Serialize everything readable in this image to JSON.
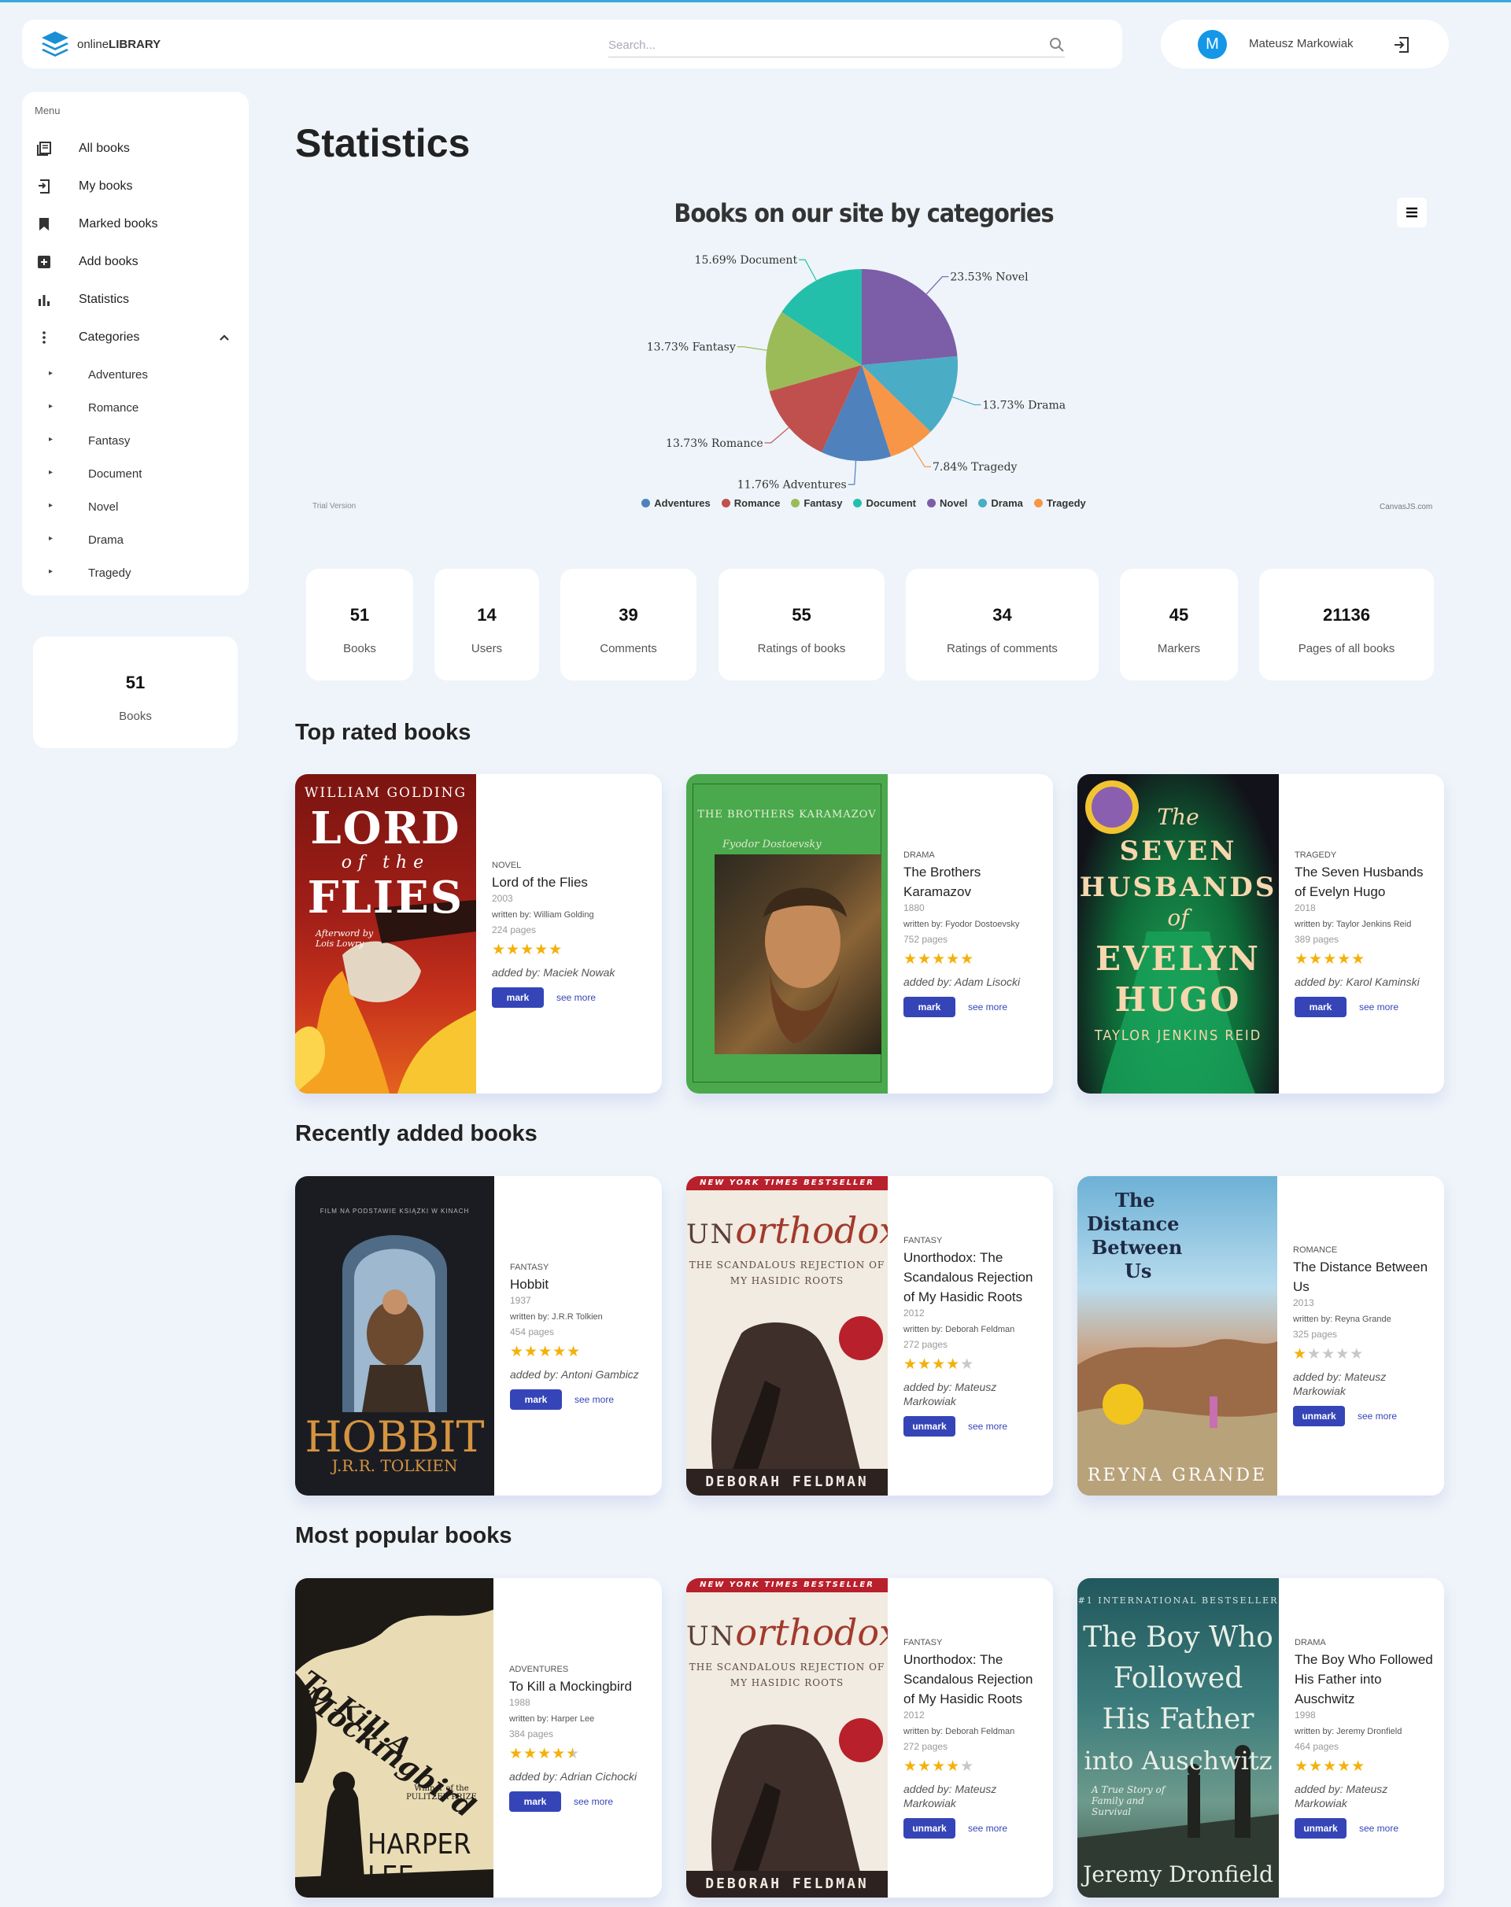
{
  "app": {
    "logo_online": "online",
    "logo_library": "LIBRARY"
  },
  "search": {
    "placeholder": "Search..."
  },
  "user": {
    "initial": "M",
    "name": "Mateusz Markowiak"
  },
  "sidebar": {
    "menu_label": "Menu",
    "items": [
      {
        "label": "All books",
        "icon": "books-icon"
      },
      {
        "label": "My books",
        "icon": "my-books-icon"
      },
      {
        "label": "Marked books",
        "icon": "bookmark-icon"
      },
      {
        "label": "Add books",
        "icon": "plus-box-icon"
      },
      {
        "label": "Statistics",
        "icon": "bar-chart-icon"
      },
      {
        "label": "Categories",
        "icon": "kebab-icon"
      }
    ],
    "categories": [
      "Adventures",
      "Romance",
      "Fantasy",
      "Document",
      "Novel",
      "Drama",
      "Tragedy"
    ],
    "stat": {
      "value": "51",
      "label": "Books"
    }
  },
  "page": {
    "title": "Statistics"
  },
  "chart_data": {
    "type": "pie",
    "title": "Books on our site by categories",
    "slices": [
      {
        "label": "Novel",
        "value": 23.53,
        "color": "#7b5ea7",
        "text": "23.53% Novel"
      },
      {
        "label": "Drama",
        "value": 13.73,
        "color": "#4aacc5",
        "text": "13.73% Drama"
      },
      {
        "label": "Tragedy",
        "value": 7.84,
        "color": "#f79646",
        "text": "7.84% Tragedy"
      },
      {
        "label": "Adventures",
        "value": 11.76,
        "color": "#4f81bd",
        "text": "11.76% Adventures"
      },
      {
        "label": "Romance",
        "value": 13.73,
        "color": "#c0504d",
        "text": "13.73% Romance"
      },
      {
        "label": "Fantasy",
        "value": 13.73,
        "color": "#9bbb59",
        "text": "13.73% Fantasy"
      },
      {
        "label": "Document",
        "value": 15.69,
        "color": "#23bfaa",
        "text": "15.69% Document"
      }
    ],
    "legend": [
      "Adventures",
      "Romance",
      "Fantasy",
      "Document",
      "Novel",
      "Drama",
      "Tragedy"
    ],
    "legend_position": "bottom",
    "trial": "Trial Version",
    "credit": "CanvasJS.com"
  },
  "stats": [
    {
      "value": "51",
      "label": "Books"
    },
    {
      "value": "14",
      "label": "Users"
    },
    {
      "value": "39",
      "label": "Comments"
    },
    {
      "value": "55",
      "label": "Ratings of books"
    },
    {
      "value": "34",
      "label": "Ratings of comments"
    },
    {
      "value": "45",
      "label": "Markers"
    },
    {
      "value": "21136",
      "label": "Pages of all books"
    }
  ],
  "sections": {
    "top_rated": "Top rated books",
    "recent": "Recently added books",
    "popular": "Most popular books"
  },
  "buttons": {
    "mark": "mark",
    "unmark": "unmark",
    "see_more": "see more"
  },
  "top_rated": [
    {
      "category": "NOVEL",
      "title": "Lord of the Flies",
      "year": "2003",
      "author": "written by: William Golding",
      "pages": "224 pages",
      "rating": 5,
      "added": "added by: Maciek Nowak",
      "action": "mark",
      "cover": {
        "author": "WILLIAM GOLDING",
        "l1": "LORD",
        "l2": "of the",
        "l3": "FLIES",
        "note": "Afterword by Lois Lowry"
      }
    },
    {
      "category": "DRAMA",
      "title": "The Brothers Karamazov",
      "year": "1880",
      "author": "written by: Fyodor Dostoevsky",
      "pages": "752 pages",
      "rating": 5,
      "added": "added by: Adam Lisocki",
      "action": "mark",
      "cover": {
        "title": "THE BROTHERS KARAMAZOV",
        "author": "Fyodor Dostoevsky"
      }
    },
    {
      "category": "TRAGEDY",
      "title": "The Seven Husbands of Evelyn Hugo",
      "year": "2018",
      "author": "written by: Taylor Jenkins Reid",
      "pages": "389 pages",
      "rating": 5,
      "added": "added by: Karol Kaminski",
      "action": "mark",
      "cover": {
        "l1": "The",
        "l2": "SEVEN",
        "l3": "HUSBANDS",
        "l4": "of",
        "l5": "EVELYN",
        "l6": "HUGO",
        "author": "TAYLOR JENKINS REID"
      }
    }
  ],
  "recent": [
    {
      "category": "FANTASY",
      "title": "Hobbit",
      "year": "1937",
      "author": "written by: J.R.R Tolkien",
      "pages": "454 pages",
      "rating": 5,
      "added": "added by: Antoni Gambicz",
      "action": "mark",
      "cover": {
        "top": "FILM NA PODSTAWIE KSIĄŻKI W KINACH",
        "title": "HOBBIT",
        "author": "J.R.R. TOLKIEN"
      }
    },
    {
      "category": "FANTASY",
      "title": "Unorthodox: The Scandalous Rejection of My Hasidic Roots",
      "year": "2012",
      "author": "written by: Deborah Feldman",
      "pages": "272 pages",
      "rating": 4,
      "added": "added by: Mateusz Markowiak",
      "action": "unmark",
      "cover": {
        "banner": "NEW YORK TIMES BESTSELLER",
        "un": "UN",
        "orth": "orthodox",
        "sub1": "THE SCANDALOUS REJECTION OF",
        "sub2": "MY HASIDIC ROOTS",
        "author": "DEBORAH FELDMAN"
      }
    },
    {
      "category": "ROMANCE",
      "title": "The Distance Between Us",
      "year": "2013",
      "author": "written by: Reyna Grande",
      "pages": "325 pages",
      "rating": 1,
      "added": "added by: Mateusz Markowiak",
      "action": "unmark",
      "cover": {
        "l1": "The",
        "l2": "Distance",
        "l3": "Between",
        "l4": "Us",
        "author": "REYNA GRANDE"
      }
    }
  ],
  "popular": [
    {
      "category": "ADVENTURES",
      "title": "To Kill a Mockingbird",
      "year": "1988",
      "author": "written by: Harper Lee",
      "pages": "384 pages",
      "rating": 4.5,
      "added": "added by: Adrian Cichocki",
      "action": "mark",
      "cover": {
        "l1": "To Kill A",
        "l2": "Mockingbird",
        "prize": "Winner of the PULITZER PRIZE",
        "author": "HARPER LEE"
      }
    },
    {
      "category": "FANTASY",
      "title": "Unorthodox: The Scandalous Rejection of My Hasidic Roots",
      "year": "2012",
      "author": "written by: Deborah Feldman",
      "pages": "272 pages",
      "rating": 4,
      "added": "added by: Mateusz Markowiak",
      "action": "unmark",
      "cover": {
        "banner": "NEW YORK TIMES BESTSELLER",
        "un": "UN",
        "orth": "orthodox",
        "sub1": "THE SCANDALOUS REJECTION OF",
        "sub2": "MY HASIDIC ROOTS",
        "author": "DEBORAH FELDMAN"
      }
    },
    {
      "category": "DRAMA",
      "title": "The Boy Who Followed His Father into Auschwitz",
      "year": "1998",
      "author": "written by: Jeremy Dronfield",
      "pages": "464 pages",
      "rating": 5,
      "added": "added by: Mateusz Markowiak",
      "action": "unmark",
      "cover": {
        "top": "#1 INTERNATIONAL BESTSELLER",
        "l1": "The Boy Who",
        "l2": "Followed",
        "l3": "His Father",
        "l4": "into Auschwitz",
        "sub": "A True Story of Family and Survival",
        "author": "Jeremy Dronfield"
      }
    }
  ]
}
